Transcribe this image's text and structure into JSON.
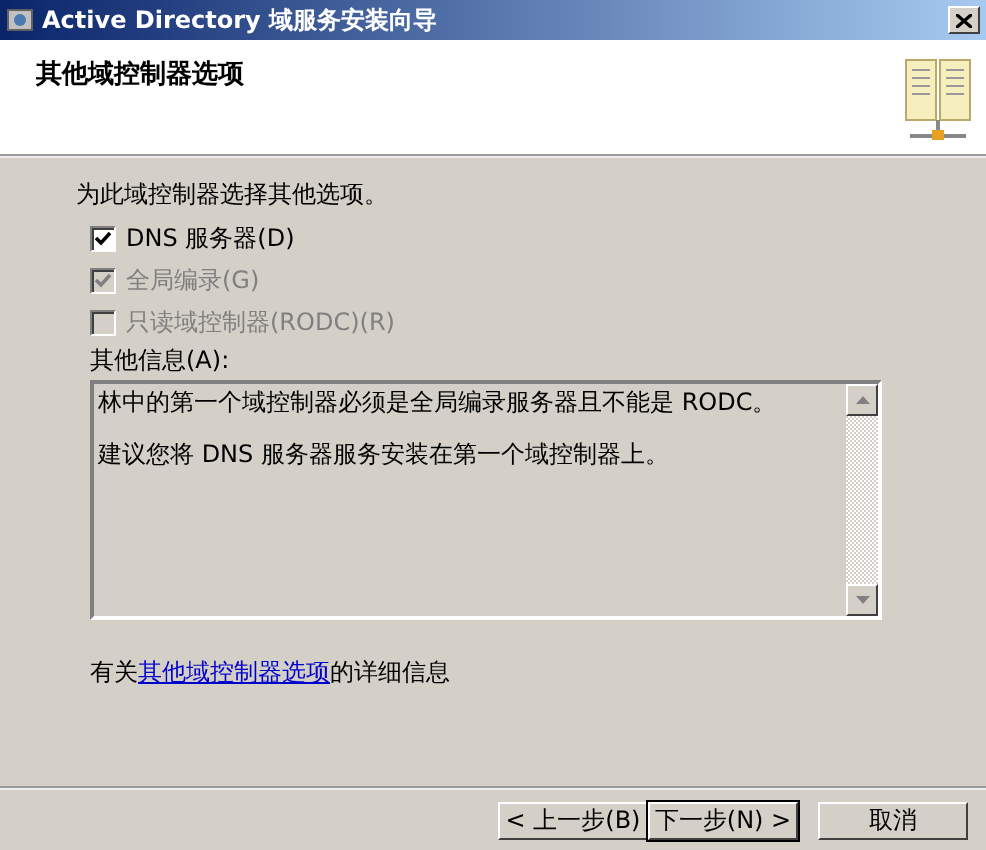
{
  "window": {
    "title": "Active Directory 域服务安装向导"
  },
  "header": {
    "title": "其他域控制器选项"
  },
  "intro": "为此域控制器选择其他选项。",
  "options": [
    {
      "label": "DNS 服务器(D)",
      "checked": true,
      "disabled": false
    },
    {
      "label": "全局编录(G)",
      "checked": true,
      "disabled": true
    },
    {
      "label": "只读域控制器(RODC)(R)",
      "checked": false,
      "disabled": true
    }
  ],
  "info": {
    "label": "其他信息(A):",
    "lines": [
      "林中的第一个域控制器必须是全局编录服务器且不能是 RODC。",
      "建议您将 DNS 服务器服务安装在第一个域控制器上。"
    ]
  },
  "more_info": {
    "prefix": "有关",
    "link": "其他域控制器选项",
    "suffix": "的详细信息"
  },
  "buttons": [
    {
      "label": "< 上一步(B)",
      "kind": "back"
    },
    {
      "label": "下一步(N) >",
      "kind": "next"
    },
    {
      "label": "取消",
      "kind": "cancel"
    }
  ]
}
